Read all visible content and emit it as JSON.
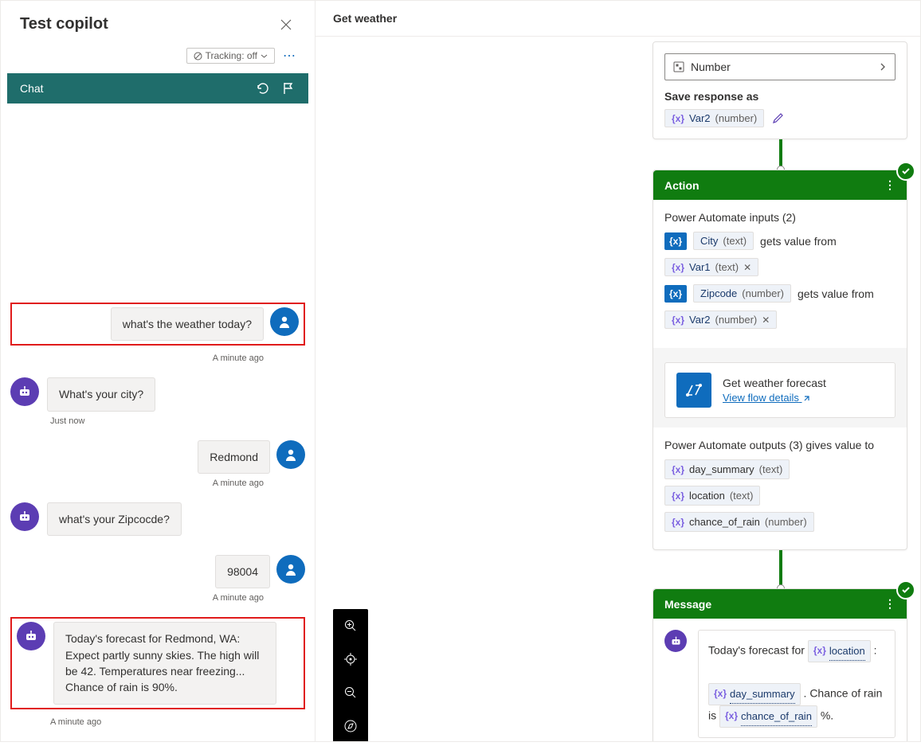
{
  "left": {
    "title": "Test copilot",
    "tracking_label": "Tracking: off",
    "chat_label": "Chat",
    "messages": [
      {
        "role": "user",
        "text": "what's the weather today?",
        "ts": "A minute ago",
        "highlight": true
      },
      {
        "role": "bot",
        "text": "What's your city?",
        "ts": "Just now"
      },
      {
        "role": "user",
        "text": "Redmond",
        "ts": "A minute ago"
      },
      {
        "role": "bot",
        "text": "what's your Zipcocde?",
        "ts": ""
      },
      {
        "role": "user",
        "text": "98004",
        "ts": "A minute ago"
      },
      {
        "role": "bot",
        "text": "Today's forecast for Redmond, WA: Expect partly sunny skies. The high will be 42. Temperatures near freezing... Chance of rain is 90%.",
        "ts": "A minute ago",
        "highlight": true
      }
    ]
  },
  "right": {
    "header": "Get weather",
    "number_card": {
      "select_label": "Number",
      "save_label": "Save response as",
      "var_name": "Var2",
      "var_type": "(number)"
    },
    "action": {
      "title": "Action",
      "inputs_label": "Power Automate inputs (2)",
      "city_label": "City",
      "city_type": "(text)",
      "gets_from": "gets value from",
      "var1_name": "Var1",
      "var1_type": "(text)",
      "zip_label": "Zipcode",
      "zip_type": "(number)",
      "var2_name": "Var2",
      "var2_type": "(number)",
      "flow_title": "Get weather forecast",
      "flow_link": "View flow details",
      "outputs_label": "Power Automate outputs (3) gives value to",
      "outputs": [
        {
          "name": "day_summary",
          "type": "(text)"
        },
        {
          "name": "location",
          "type": "(text)"
        },
        {
          "name": "chance_of_rain",
          "type": "(number)"
        }
      ]
    },
    "message_node": {
      "title": "Message",
      "prefix": "Today's forecast for",
      "var1": "location",
      "mid1": ":",
      "var2": "day_summary",
      "mid2": ". Chance of rain is",
      "var3": "chance_of_rain",
      "suffix": "%."
    }
  }
}
